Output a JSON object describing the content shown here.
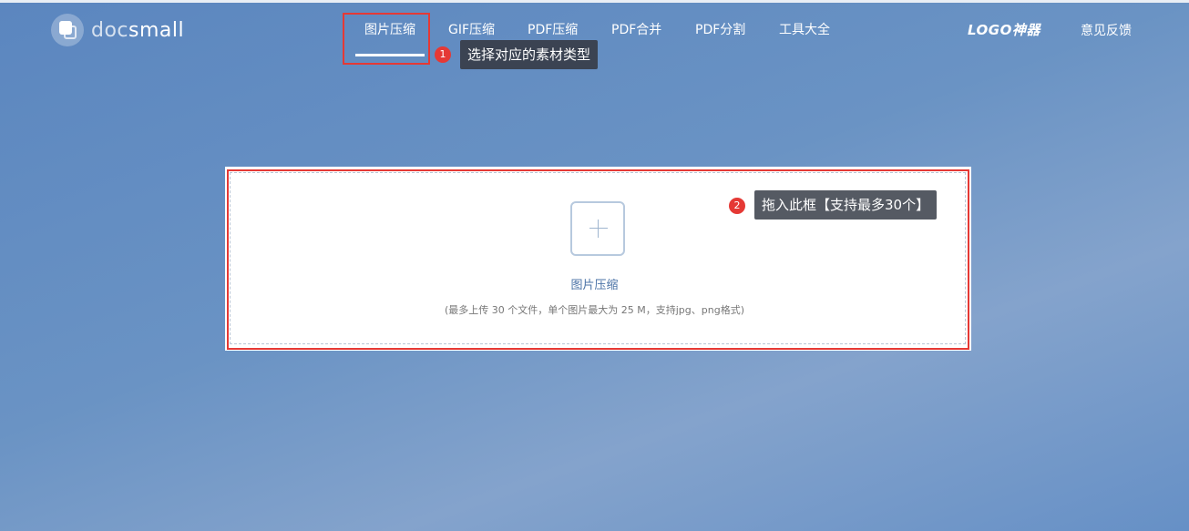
{
  "logo": {
    "prefix": "doc",
    "suffix": "small"
  },
  "nav": {
    "items": [
      "图片压缩",
      "GIF压缩",
      "PDF压缩",
      "PDF合并",
      "PDF分割",
      "工具大全"
    ],
    "active_index": 0
  },
  "header_right": {
    "brand_logo": "LOGO神器",
    "feedback": "意见反馈"
  },
  "tips": {
    "step1": {
      "number": "1",
      "text": "选择对应的素材类型"
    },
    "step2": {
      "number": "2",
      "text": "拖入此框【支持最多30个】"
    }
  },
  "upload": {
    "title": "图片压缩",
    "hint": "(最多上传 30 个文件，单个图片最大为 25 M，支持jpg、png格式)"
  },
  "colors": {
    "accent": "#e53935",
    "bg_start": "#5b86bf",
    "bg_end": "#84a3cc"
  }
}
